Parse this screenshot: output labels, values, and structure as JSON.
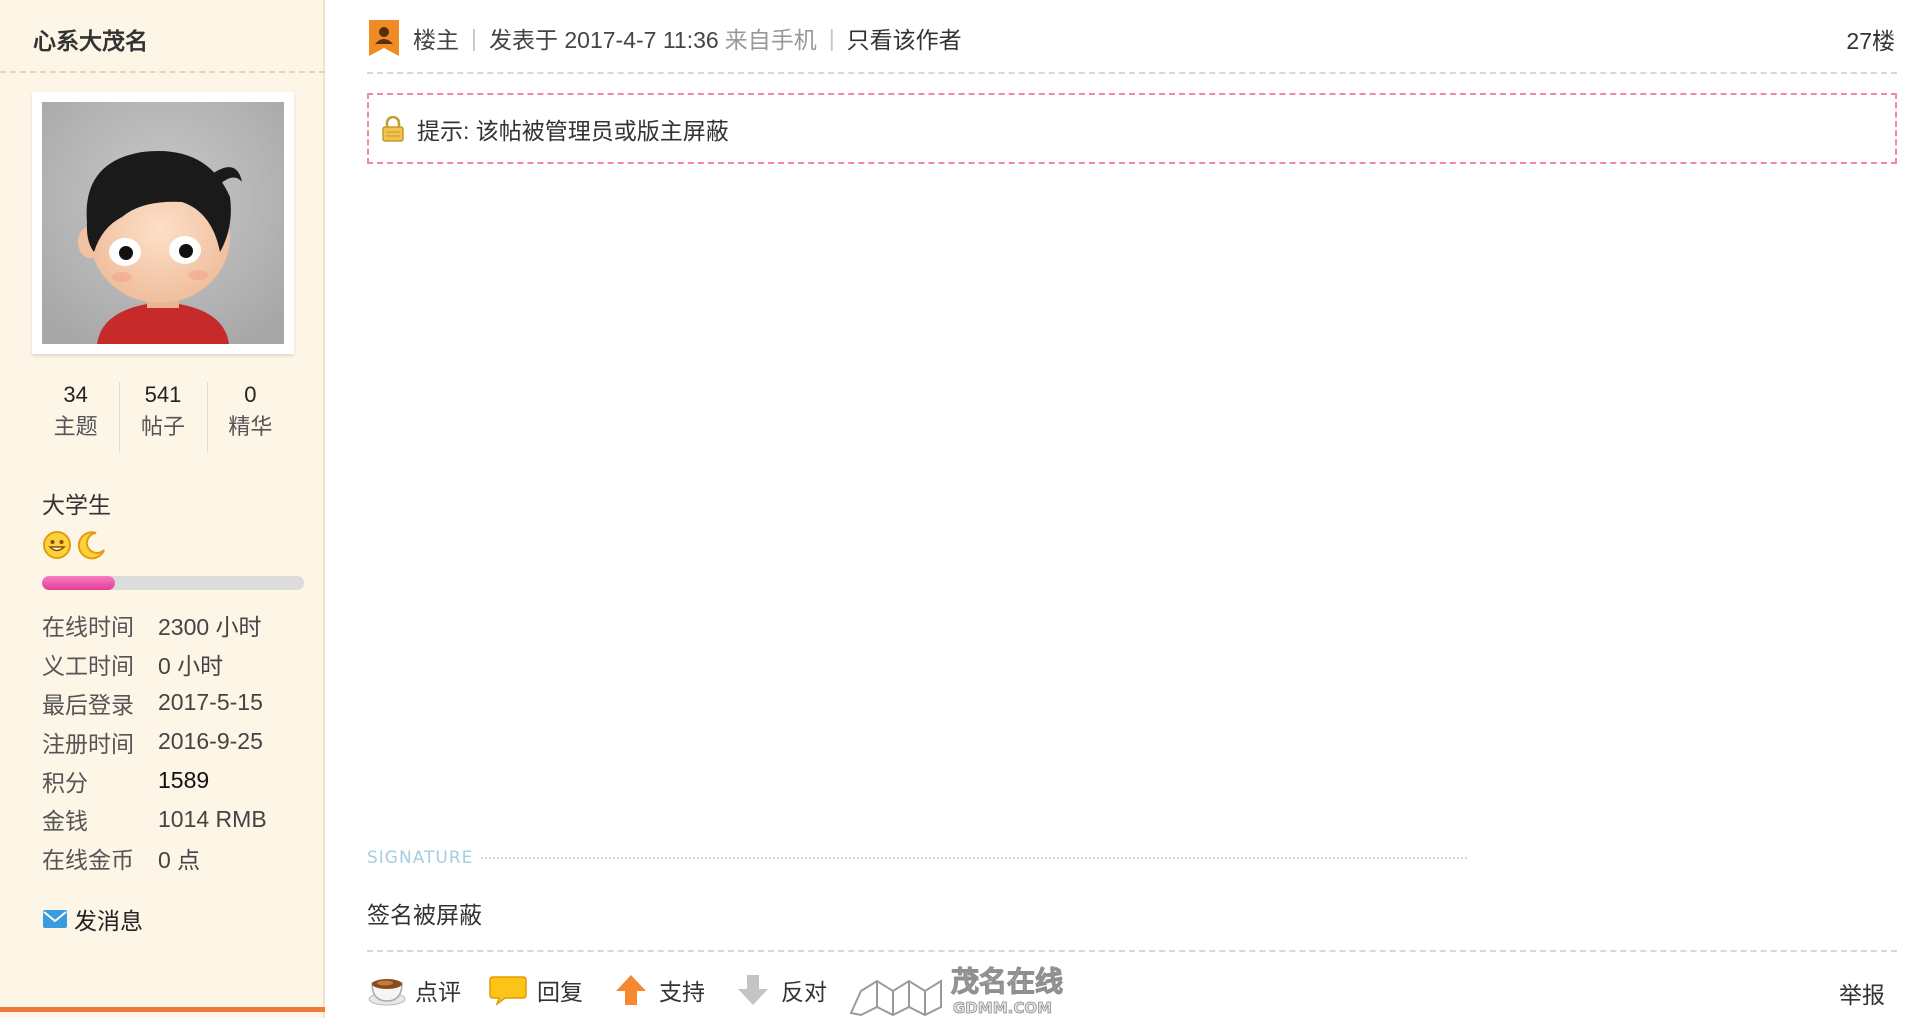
{
  "author": {
    "name": "心系大茂名",
    "stats": [
      {
        "value": "34",
        "label": "主题"
      },
      {
        "value": "541",
        "label": "帖子"
      },
      {
        "value": "0",
        "label": "精华"
      }
    ],
    "group": "大学生",
    "rank_icons": [
      "sun-face-icon",
      "moon-icon"
    ],
    "rank_progress": 0.28,
    "info": [
      {
        "label": "在线时间",
        "value": "2300 小时"
      },
      {
        "label": "义工时间",
        "value": "0 小时"
      },
      {
        "label": "最后登录",
        "value": "2017-5-15"
      },
      {
        "label": "注册时间",
        "value": "2016-9-25"
      },
      {
        "label": "积分",
        "value": "1589"
      },
      {
        "label": "金钱",
        "value": "1014 RMB"
      },
      {
        "label": "在线金币",
        "value": "0 点"
      }
    ],
    "send_message_label": "发消息"
  },
  "post": {
    "op_label": "楼主",
    "posted_at": "发表于 2017-4-7 11:36",
    "source": "来自手机",
    "only_author_label": "只看该作者",
    "floor": "27楼",
    "notice": "提示: 该帖被管理员或版主屏蔽",
    "signature_tag": "SIGNATURE",
    "signature_text": "签名被屏蔽"
  },
  "actions": {
    "comment_label": "点评",
    "reply_label": "回复",
    "support_label": "支持",
    "oppose_label": "反对",
    "report_label": "举报"
  },
  "watermark": {
    "line1": "茂名在线",
    "line2": "GDMM.COM"
  },
  "colors": {
    "sidebar_bg": "#fdf5e6",
    "accent_orange": "#ef7a3a",
    "notice_border": "#f08aa0",
    "rank_bar_fill": "#e43c98"
  }
}
